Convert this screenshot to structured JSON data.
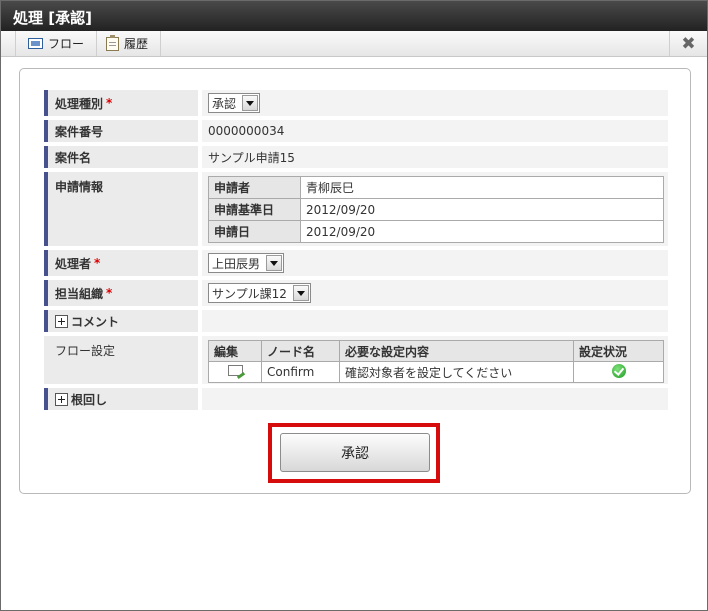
{
  "window": {
    "title": "処理 [承認]"
  },
  "toolbar": {
    "flow_label": "フロー",
    "history_label": "履歴",
    "close_glyph": "✖"
  },
  "form": {
    "process_type": {
      "label": "処理種別",
      "required_mark": "*",
      "value": "承認"
    },
    "case_number": {
      "label": "案件番号",
      "value": "0000000034"
    },
    "case_name": {
      "label": "案件名",
      "value": "サンプル申請15"
    },
    "application_info": {
      "label": "申請情報",
      "rows": [
        {
          "key": "申請者",
          "value": "青柳辰巳"
        },
        {
          "key": "申請基準日",
          "value": "2012/09/20"
        },
        {
          "key": "申請日",
          "value": "2012/09/20"
        }
      ]
    },
    "processor": {
      "label": "処理者",
      "required_mark": "*",
      "value": "上田辰男"
    },
    "organization": {
      "label": "担当組織",
      "required_mark": "*",
      "value": "サンプル課12"
    },
    "comment": {
      "label": "コメント"
    },
    "flow_settings": {
      "label": "フロー設定",
      "headers": [
        "編集",
        "ノード名",
        "必要な設定内容",
        "設定状況"
      ],
      "rows": [
        {
          "node": "Confirm",
          "requirement": "確認対象者を設定してください",
          "status_icon": "check-circle-icon"
        }
      ]
    },
    "nemawashi": {
      "label": "根回し"
    }
  },
  "actions": {
    "approve_label": "承認"
  },
  "colors": {
    "label_accent": "#46518e",
    "highlight": "#d60b0b",
    "required": "#dd0000"
  }
}
